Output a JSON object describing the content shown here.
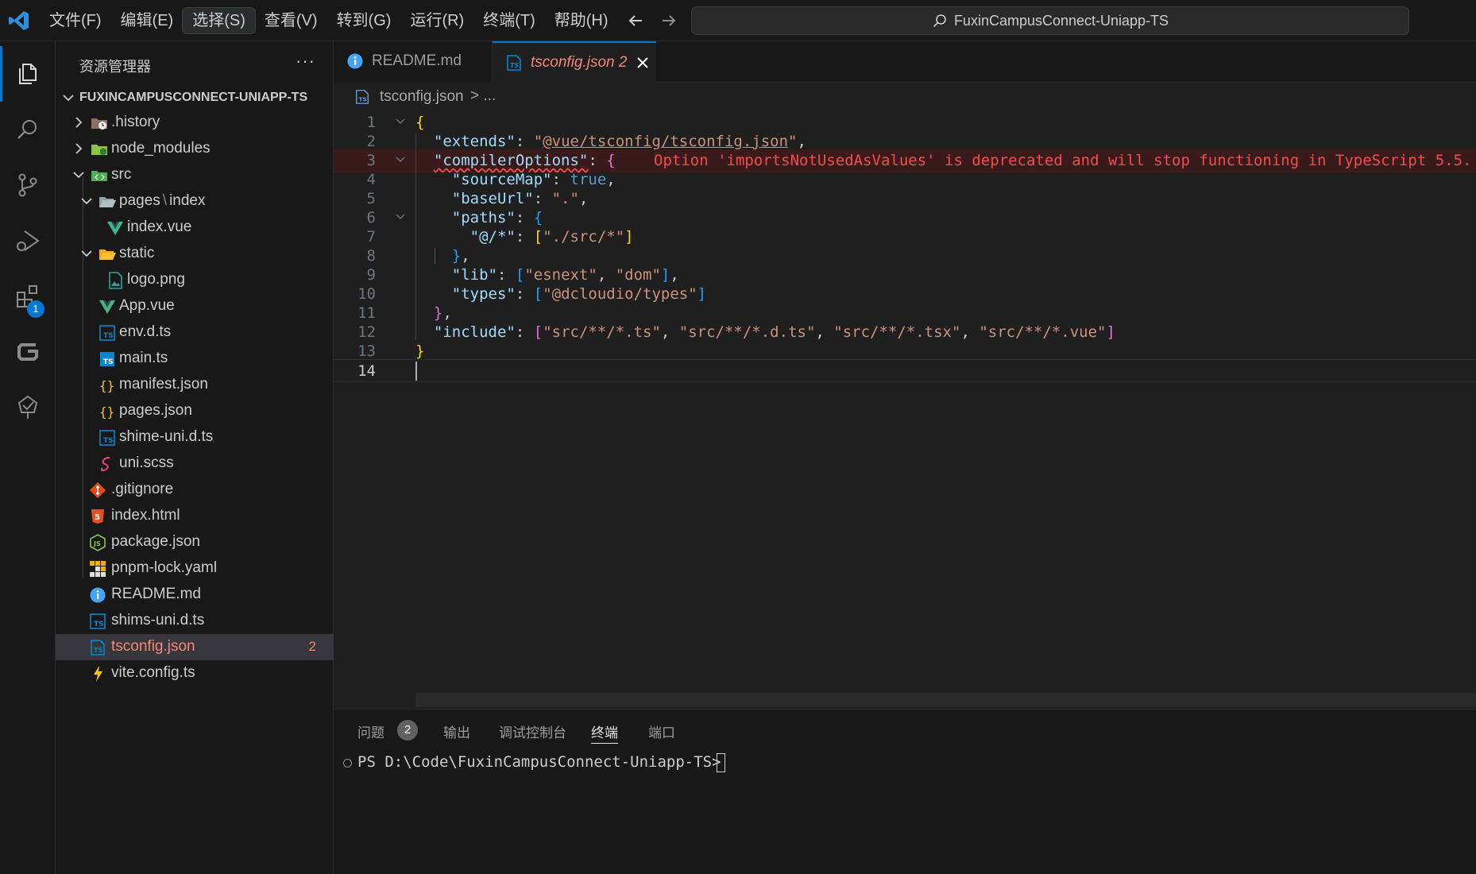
{
  "menubar": {
    "items": [
      "文件(F)",
      "编辑(E)",
      "选择(S)",
      "查看(V)",
      "转到(G)",
      "运行(R)",
      "终端(T)",
      "帮助(H)"
    ]
  },
  "command_center": {
    "title": "FuxinCampusConnect-Uniapp-TS"
  },
  "activity_bar": {
    "extensions_badge": "1"
  },
  "explorer": {
    "header": "资源管理器",
    "more": "···",
    "root": "FUXINCAMPUSCONNECT-UNIAPP-TS",
    "items": [
      {
        "label": ".history",
        "icon": "history-folder-icon"
      },
      {
        "label": "node_modules",
        "icon": "node-folder-icon"
      },
      {
        "label": "src",
        "icon": "src-folder-icon"
      },
      {
        "label": "pages",
        "sep": "\\",
        "label2": "index",
        "icon": "open-folder-icon"
      },
      {
        "label": "index.vue",
        "icon": "vue-icon"
      },
      {
        "label": "static",
        "icon": "open-folder-icon"
      },
      {
        "label": "logo.png",
        "icon": "image-icon"
      },
      {
        "label": "App.vue",
        "icon": "vue-icon"
      },
      {
        "label": "env.d.ts",
        "icon": "ts-def-icon"
      },
      {
        "label": "main.ts",
        "icon": "ts-icon"
      },
      {
        "label": "manifest.json",
        "icon": "json-icon"
      },
      {
        "label": "pages.json",
        "icon": "json-icon"
      },
      {
        "label": "shime-uni.d.ts",
        "icon": "ts-def-icon"
      },
      {
        "label": "uni.scss",
        "icon": "scss-icon"
      },
      {
        "label": ".gitignore",
        "icon": "git-icon"
      },
      {
        "label": "index.html",
        "icon": "html-icon"
      },
      {
        "label": "package.json",
        "icon": "node-json-icon"
      },
      {
        "label": "pnpm-lock.yaml",
        "icon": "pnpm-icon"
      },
      {
        "label": "README.md",
        "icon": "info-icon"
      },
      {
        "label": "shims-uni.d.ts",
        "icon": "ts-def-icon"
      },
      {
        "label": "tsconfig.json",
        "icon": "tsconfig-icon",
        "problems": "2"
      },
      {
        "label": "vite.config.ts",
        "icon": "vite-icon"
      }
    ]
  },
  "tabs": [
    {
      "label": "README.md",
      "active": false
    },
    {
      "label": "tsconfig.json 2",
      "active": true
    }
  ],
  "breadcrumb": {
    "file": "tsconfig.json",
    "rest": "> ..."
  },
  "editor": {
    "line_numbers": [
      "1",
      "2",
      "3",
      "4",
      "5",
      "6",
      "7",
      "8",
      "9",
      "10",
      "11",
      "12",
      "13",
      "14"
    ],
    "current_line": "14",
    "diagnostic": "Option 'importsNotUsedAsValues' is deprecated and will stop functioning in TypeScript 5.5."
  },
  "panel": {
    "tabs": [
      "问题",
      "输出",
      "调试控制台",
      "终端",
      "端口"
    ],
    "problems_count": "2",
    "active_tab": "终端",
    "terminal_prompt": "PS D:\\Code\\FuxinCampusConnect-Uniapp-TS>"
  },
  "colors": {
    "accent": "#0078d4",
    "error": "#f48771",
    "background": "#1f1f1f",
    "sidebar": "#181818"
  }
}
